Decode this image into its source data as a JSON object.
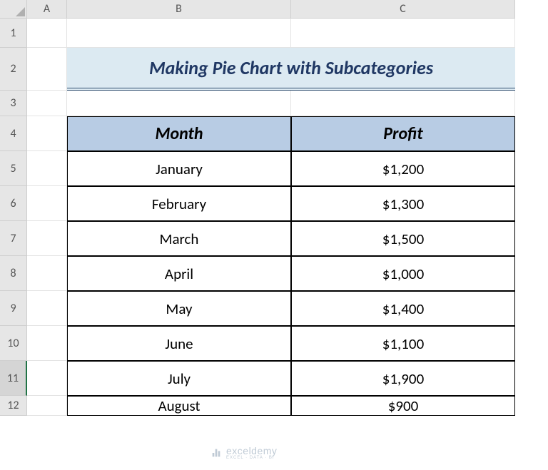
{
  "columns": [
    "A",
    "B",
    "C"
  ],
  "rows": [
    "1",
    "2",
    "3",
    "4",
    "5",
    "6",
    "7",
    "8",
    "9",
    "10",
    "11",
    "12"
  ],
  "selected_row": "11",
  "title": "Making Pie Chart with Subcategories",
  "table": {
    "headers": [
      "Month",
      "Profit"
    ],
    "rows": [
      {
        "month": "January",
        "profit": "$1,200"
      },
      {
        "month": "February",
        "profit": "$1,300"
      },
      {
        "month": "March",
        "profit": "$1,500"
      },
      {
        "month": "April",
        "profit": "$1,000"
      },
      {
        "month": "May",
        "profit": "$1,400"
      },
      {
        "month": "June",
        "profit": "$1,100"
      },
      {
        "month": "July",
        "profit": "$1,900"
      },
      {
        "month": "August",
        "profit": "$900"
      }
    ]
  },
  "watermark": {
    "main": "exceldemy",
    "sub": "EXCEL · DATA · BI"
  },
  "chart_data": {
    "type": "table",
    "categories": [
      "January",
      "February",
      "March",
      "April",
      "May",
      "June",
      "July",
      "August"
    ],
    "values": [
      1200,
      1300,
      1500,
      1000,
      1400,
      1100,
      1900,
      900
    ],
    "title": "Making Pie Chart with Subcategories",
    "xlabel": "Month",
    "ylabel": "Profit"
  }
}
